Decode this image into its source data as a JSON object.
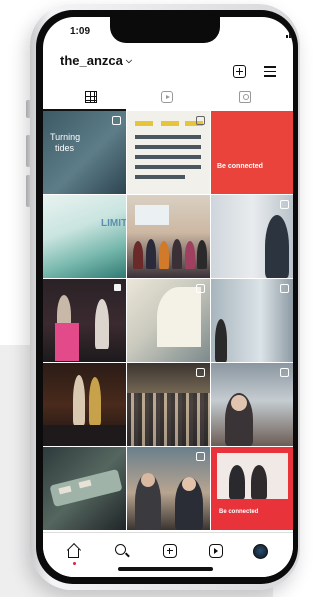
{
  "status_bar": {
    "time": "1:09"
  },
  "profile": {
    "username": "the_anzca"
  },
  "tabs": [
    {
      "name": "grid",
      "selected": true
    },
    {
      "name": "reels",
      "selected": false
    },
    {
      "name": "tagged",
      "selected": false
    }
  ],
  "posts": [
    {
      "caption_line1": "Turning",
      "caption_line2": "tides"
    },
    {
      "caption": ""
    },
    {
      "caption": "Be connected"
    },
    {
      "caption": "LIMIT"
    },
    {
      "caption": ""
    },
    {
      "caption": ""
    },
    {
      "caption": ""
    },
    {
      "caption": ""
    },
    {
      "caption": ""
    },
    {
      "caption": ""
    },
    {
      "caption": ""
    },
    {
      "caption": ""
    },
    {
      "caption": ""
    },
    {
      "caption": ""
    },
    {
      "caption": "Be connected"
    }
  ],
  "bottom_nav": [
    {
      "icon": "home-icon"
    },
    {
      "icon": "search-icon"
    },
    {
      "icon": "create-post-icon"
    },
    {
      "icon": "reels-icon"
    },
    {
      "icon": "profile-avatar"
    }
  ],
  "colors": {
    "brand_red": "#e9433b",
    "notification_dot": "#e0263a"
  }
}
